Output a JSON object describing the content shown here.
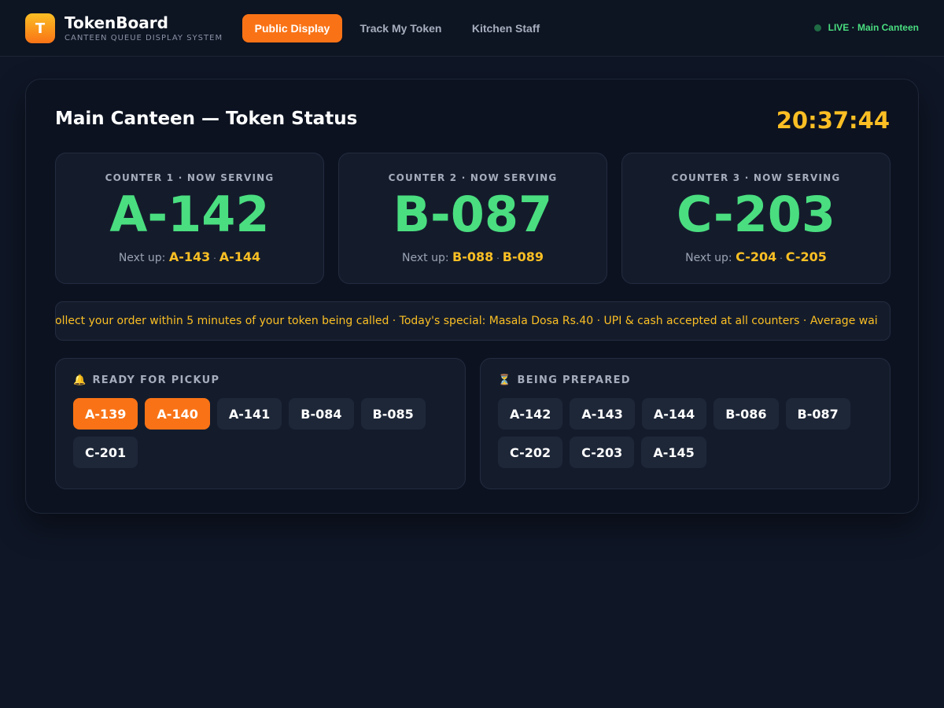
{
  "brand": {
    "logo_letter": "T",
    "name": "TokenBoard",
    "subtitle": "CANTEEN QUEUE DISPLAY SYSTEM"
  },
  "nav": {
    "items": [
      {
        "label": "Public Display",
        "active": true
      },
      {
        "label": "Track My Token",
        "active": false
      },
      {
        "label": "Kitchen Staff",
        "active": false
      }
    ]
  },
  "status": {
    "live_label": "LIVE · Main Canteen"
  },
  "main": {
    "title": "Main Canteen — Token Status",
    "clock": "20:37:44",
    "counters": [
      {
        "label": "COUNTER 1 · NOW SERVING",
        "token": "A-142",
        "next_label": "Next up:",
        "next": [
          "A-143",
          "A-144"
        ]
      },
      {
        "label": "COUNTER 2 · NOW SERVING",
        "token": "B-087",
        "next_label": "Next up:",
        "next": [
          "B-088",
          "B-089"
        ]
      },
      {
        "label": "COUNTER 3 · NOW SERVING",
        "token": "C-203",
        "next_label": "Next up:",
        "next": [
          "C-204",
          "C-205"
        ]
      }
    ],
    "ticker": "ollect your order within 5 minutes of your token being called  ·  Today's special: Masala Dosa Rs.40  ·  UPI & cash accepted at all counters  ·  Average wai",
    "ready": {
      "icon": "🔔",
      "title": "READY FOR PICKUP",
      "tokens": [
        {
          "token": "A-139",
          "highlight": true
        },
        {
          "token": "A-140",
          "highlight": true
        },
        {
          "token": "A-141",
          "highlight": false
        },
        {
          "token": "B-084",
          "highlight": false
        },
        {
          "token": "B-085",
          "highlight": false
        },
        {
          "token": "C-201",
          "highlight": false
        }
      ]
    },
    "preparing": {
      "icon": "⏳",
      "title": "BEING PREPARED",
      "tokens": [
        "A-142",
        "A-143",
        "A-144",
        "B-086",
        "B-087",
        "C-202",
        "C-203",
        "A-145"
      ]
    }
  },
  "colors": {
    "accent": "#f97316",
    "serving": "#4ade80",
    "highlight": "#fbbf24",
    "background": "#0f1626"
  }
}
